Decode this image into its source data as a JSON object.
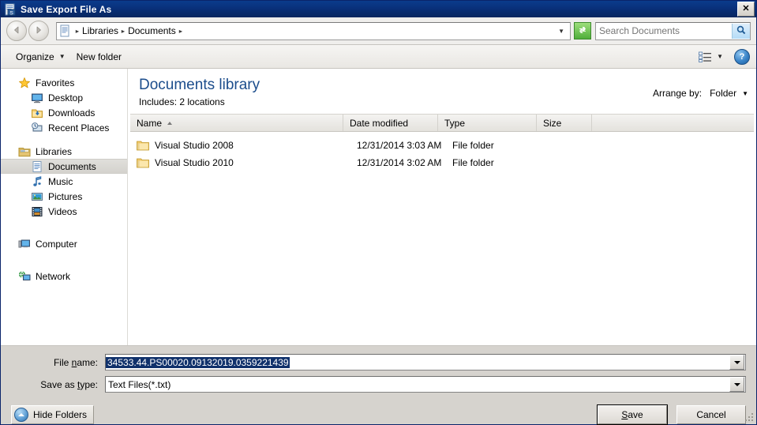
{
  "window": {
    "title": "Save Export File As",
    "title_icon": "save-document-icon",
    "close_label": "✕"
  },
  "addressbar": {
    "back_icon": "back-arrow-icon",
    "forward_icon": "forward-arrow-icon",
    "path_icon": "library-document-icon",
    "crumbs": [
      {
        "label": "Libraries"
      },
      {
        "label": "Documents"
      }
    ],
    "separator": "▸",
    "history_caret": "▼",
    "refresh_icon": "refresh-icon",
    "search_placeholder": "Search Documents",
    "search_value": "",
    "search_icon": "magnifier-icon"
  },
  "toolbar": {
    "organize_label": "Organize",
    "organize_caret": "▼",
    "new_folder_label": "New folder",
    "view_icon": "view-list-icon",
    "view_caret": "▼",
    "help_label": "?"
  },
  "sidebar": {
    "groups": [
      {
        "header": {
          "label": "Favorites",
          "icon": "star-icon"
        },
        "items": [
          {
            "label": "Desktop",
            "icon": "desktop-icon",
            "selected": false
          },
          {
            "label": "Downloads",
            "icon": "downloads-icon",
            "selected": false
          },
          {
            "label": "Recent Places",
            "icon": "recent-places-icon",
            "selected": false
          }
        ]
      },
      {
        "header": {
          "label": "Libraries",
          "icon": "libraries-icon"
        },
        "items": [
          {
            "label": "Documents",
            "icon": "documents-icon",
            "selected": true
          },
          {
            "label": "Music",
            "icon": "music-icon",
            "selected": false
          },
          {
            "label": "Pictures",
            "icon": "pictures-icon",
            "selected": false
          },
          {
            "label": "Videos",
            "icon": "videos-icon",
            "selected": false
          }
        ]
      },
      {
        "header": {
          "label": "Computer",
          "icon": "computer-icon"
        },
        "items": []
      },
      {
        "header": {
          "label": "Network",
          "icon": "network-icon"
        },
        "items": []
      }
    ]
  },
  "library": {
    "title": "Documents library",
    "subtitle": "Includes:  2 locations",
    "arrange_label": "Arrange by:",
    "arrange_value": "Folder",
    "arrange_caret": "▼"
  },
  "filelist": {
    "columns": [
      {
        "label": "Name",
        "sorted": "asc"
      },
      {
        "label": "Date modified",
        "sorted": ""
      },
      {
        "label": "Type",
        "sorted": ""
      },
      {
        "label": "Size",
        "sorted": ""
      }
    ],
    "rows": [
      {
        "icon": "folder-icon",
        "name": "Visual Studio 2008",
        "date_modified": "12/31/2014 3:03 AM",
        "type": "File folder",
        "size": ""
      },
      {
        "icon": "folder-icon",
        "name": "Visual Studio 2010",
        "date_modified": "12/31/2014 3:02 AM",
        "type": "File folder",
        "size": ""
      }
    ]
  },
  "form": {
    "filename_label_pre": "File ",
    "filename_label_key": "n",
    "filename_label_post": "ame:",
    "filename_value": "34533.44.PS00020.09132019.0359221439",
    "filename_selected": true,
    "filetype_label_pre": "Save as ",
    "filetype_label_key": "t",
    "filetype_label_post": "ype:",
    "filetype_value": "Text Files(*.txt)"
  },
  "buttons": {
    "hide_folders_label": "Hide Folders",
    "hide_folders_icon": "collapse-up-icon",
    "save_key": "S",
    "save_rest": "ave",
    "cancel_label": "Cancel"
  },
  "colors": {
    "titlebar": "#09307a",
    "library_title": "#1c4d8c",
    "selection": "#10316b",
    "dialog_face": "#d6d3ce",
    "refresh_green": "#4fae3a"
  }
}
